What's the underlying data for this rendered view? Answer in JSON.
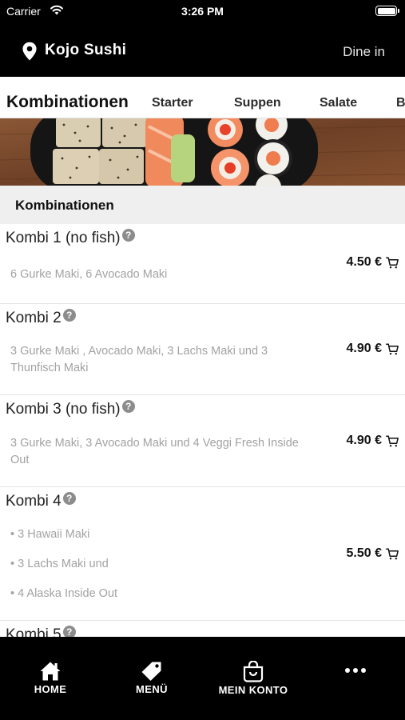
{
  "status_bar": {
    "carrier": "Carrier",
    "time": "3:26 PM"
  },
  "header": {
    "store_name": "Kojo Sushi",
    "order_mode": "Dine in"
  },
  "categories": [
    "Kombinationen",
    "Starter",
    "Suppen",
    "Salate",
    "B"
  ],
  "active_category": "Kombinationen",
  "section_title": "Kombinationen",
  "items": [
    {
      "name": "Kombi 1 (no fish)",
      "description": "6 Gurke Maki, 6 Avocado Maki",
      "price": "4.50 €"
    },
    {
      "name": "Kombi 2",
      "description": "3 Gurke Maki , Avocado Maki, 3 Lachs Maki und 3 Thunfisch Maki",
      "price": "4.90 €"
    },
    {
      "name": "Kombi 3 (no fish)",
      "description": "3 Gurke Maki, 3 Avocado Maki und 4 Veggi Fresh Inside Out",
      "price": "4.90 €"
    },
    {
      "name": "Kombi 4",
      "bullets": [
        "• 3 Hawaii Maki",
        "• 3 Lachs Maki und",
        "• 4 Alaska Inside Out"
      ],
      "price": "5.50 €"
    },
    {
      "name": "Kombi 5"
    }
  ],
  "nav": {
    "home": "HOME",
    "menu": "MENÜ",
    "account": "MEIN KONTO"
  },
  "icons": {
    "location": "map-pin-icon",
    "info": "question-circle-icon",
    "cart": "cart-icon",
    "home": "home-icon",
    "menu": "price-tag-icon",
    "account": "shopping-bag-icon",
    "more": "more-dots-icon"
  },
  "colors": {
    "bar_background": "#000000",
    "section_background": "#efefef",
    "description_text": "#a2a2a2"
  }
}
